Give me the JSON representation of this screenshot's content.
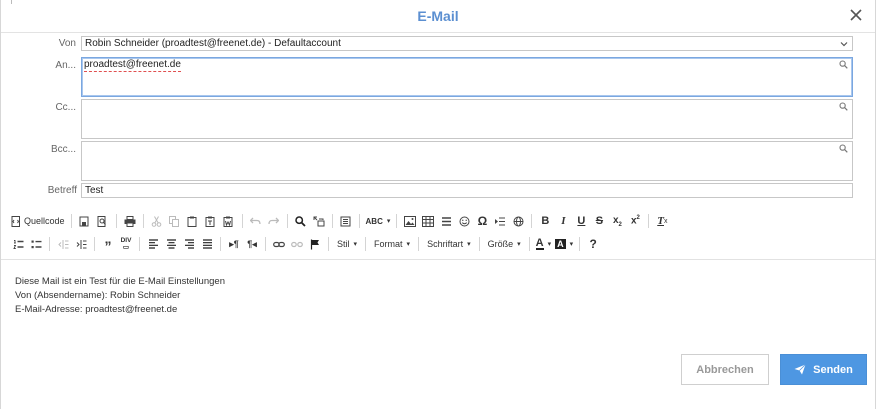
{
  "dialog": {
    "title": "E-Mail"
  },
  "fields": {
    "from_label": "Von",
    "from_value": "Robin Schneider (proadtest@freenet.de) - Defaultaccount",
    "to_label": "An...",
    "to_value": "proadtest@freenet.de",
    "cc_label": "Cc...",
    "bcc_label": "Bcc...",
    "subject_label": "Betreff",
    "subject_value": "Test"
  },
  "toolbar": {
    "source_label": "Quellcode",
    "style_label": "Stil",
    "format_label": "Format",
    "font_label": "Schriftart",
    "size_label": "Größe"
  },
  "body": {
    "lines": [
      "Diese Mail ist ein Test für die E-Mail Einstellungen",
      "Von (Absendername): Robin Schneider",
      "E-Mail-Adresse: proadtest@freenet.de"
    ]
  },
  "buttons": {
    "cancel_label": "Abbrechen",
    "send_label": "Senden"
  },
  "colors": {
    "title": "#5b8fd1",
    "send_button": "#4e97e2",
    "focus_border": "#7aa7e0"
  }
}
